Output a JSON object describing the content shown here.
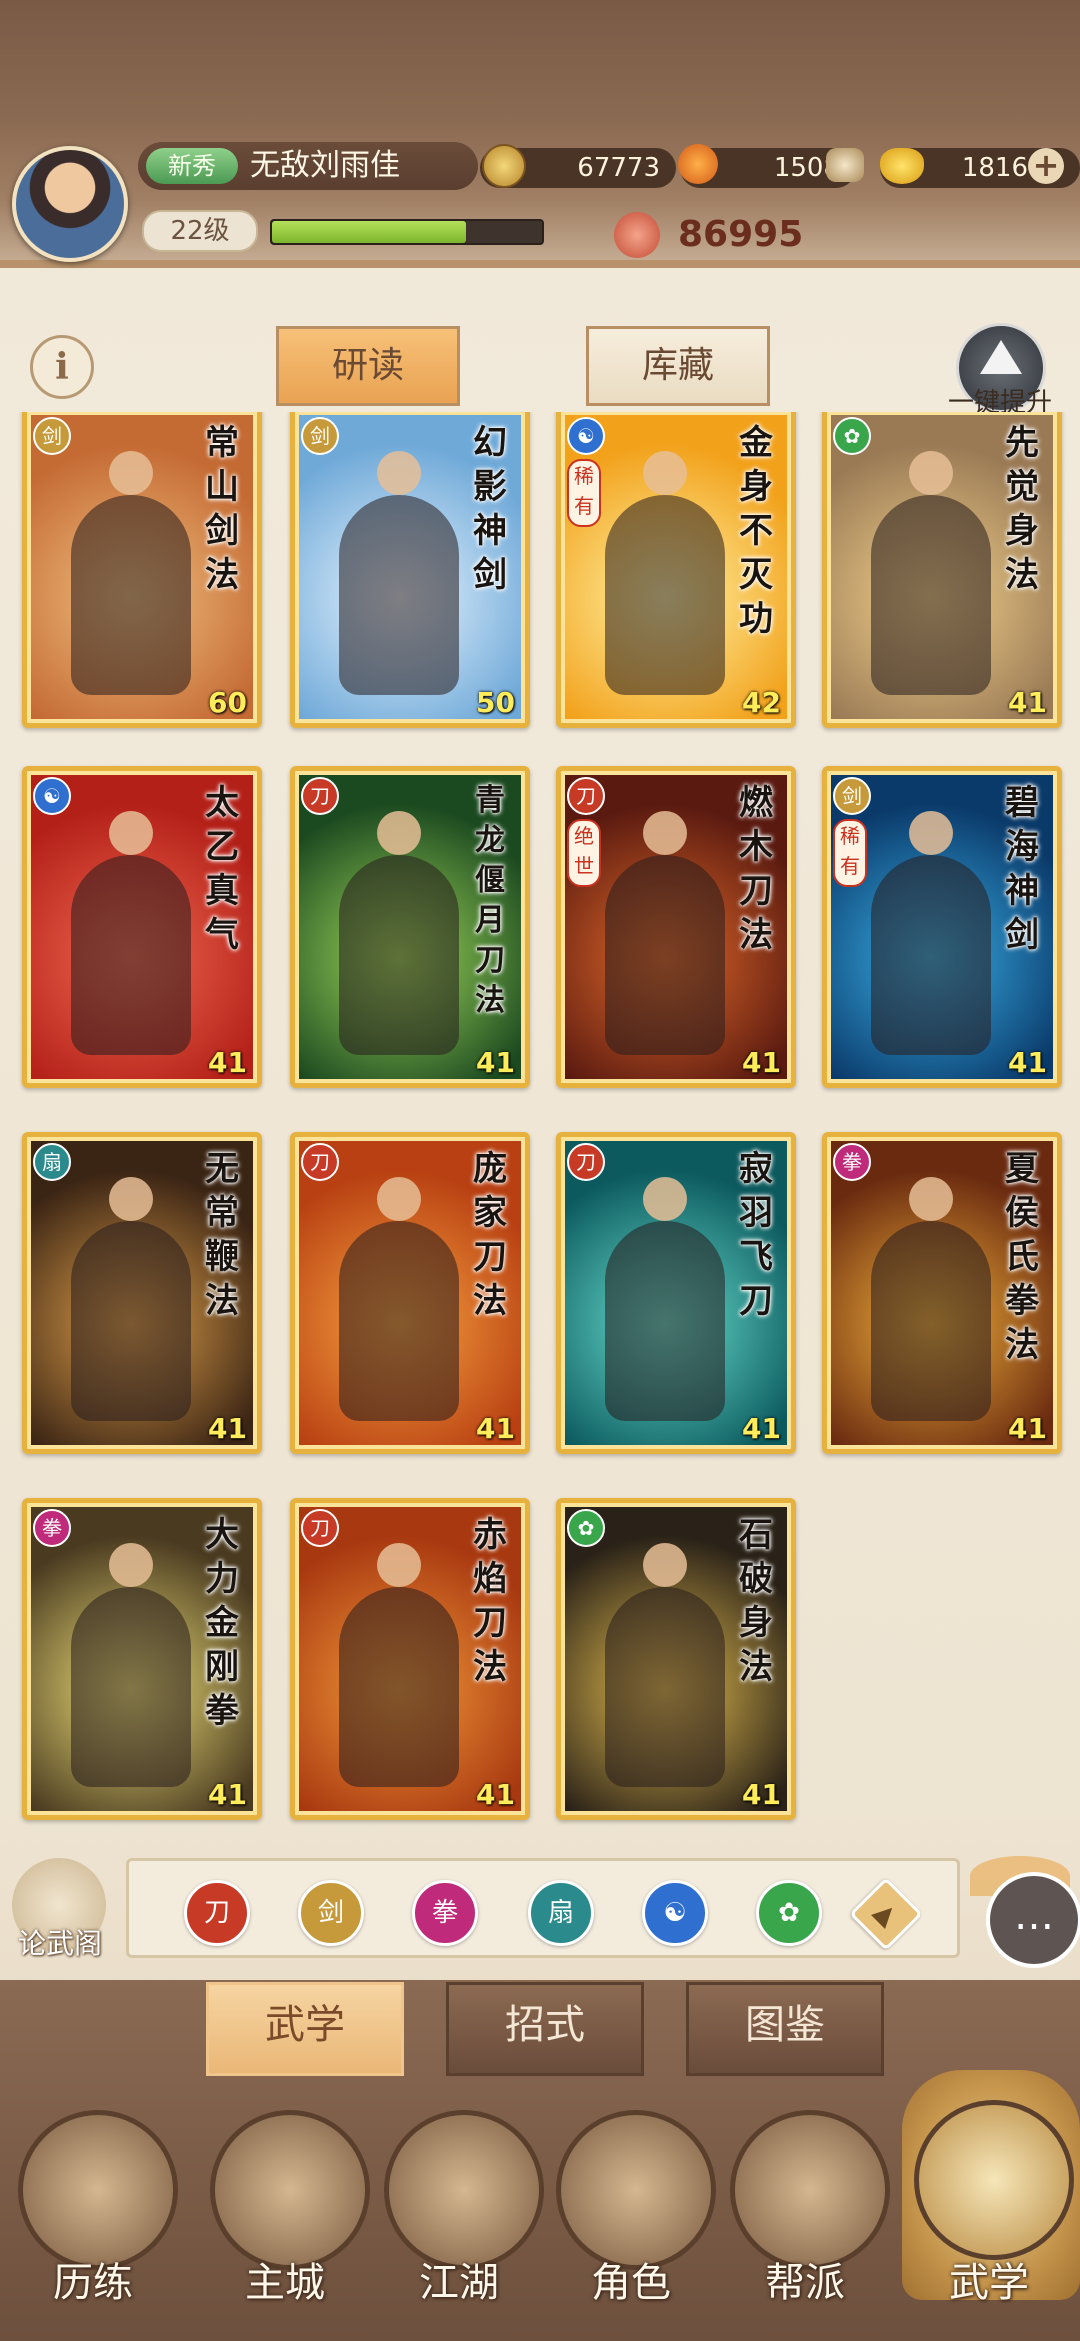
{
  "player": {
    "rank_badge": "新秀",
    "name": "无敌刘雨佳",
    "level": "22级",
    "xp_fraction": 0.72,
    "power": "86995"
  },
  "currencies": [
    {
      "icon": "copper-coin-icon",
      "value": "67773"
    },
    {
      "icon": "stamina-leaf-icon",
      "value": "1508"
    },
    {
      "icon": "gold-ingot-icon",
      "value": "1816"
    }
  ],
  "tabs": {
    "research": "研读",
    "storage": "库藏"
  },
  "upgrade": {
    "label": "一键提升"
  },
  "cards": [
    {
      "title": "常山剑法",
      "level": "60",
      "school_icon": "sword-school-icon",
      "school_color": "#c69a3a",
      "rarity": "",
      "colors": [
        "#c46a33",
        "#f0c080"
      ]
    },
    {
      "title": "幻影神剑",
      "level": "50",
      "school_icon": "sword-school-icon",
      "school_color": "#c69a3a",
      "rarity": "",
      "colors": [
        "#6fa9d8",
        "#e8f4ff"
      ]
    },
    {
      "title": "金身不灭功",
      "level": "42",
      "school_icon": "yin-yang-icon",
      "school_color": "#2e6fd0",
      "rarity": "稀有",
      "colors": [
        "#f2a11a",
        "#fff4a8"
      ]
    },
    {
      "title": "先觉身法",
      "level": "41",
      "school_icon": "leaf-school-icon",
      "school_color": "#3aa64c",
      "rarity": "",
      "colors": [
        "#9a7a55",
        "#f3d28c"
      ]
    },
    {
      "title": "太乙真气",
      "level": "41",
      "school_icon": "yin-yang-icon",
      "school_color": "#2e6fd0",
      "rarity": "",
      "colors": [
        "#b32018",
        "#f06850"
      ]
    },
    {
      "title": "青龙偃月刀法",
      "level": "41",
      "school_icon": "blade-school-icon",
      "school_color": "#c73a26",
      "rarity": "",
      "colors": [
        "#1c4a20",
        "#9fd85a"
      ]
    },
    {
      "title": "燃木刀法",
      "level": "41",
      "school_icon": "blade-school-icon",
      "school_color": "#c73a26",
      "rarity": "绝世",
      "colors": [
        "#5a1a10",
        "#e36a2a"
      ]
    },
    {
      "title": "碧海神剑",
      "level": "41",
      "school_icon": "sword-school-icon",
      "school_color": "#c69a3a",
      "rarity": "稀有",
      "colors": [
        "#0a3a6a",
        "#3ab0e8"
      ]
    },
    {
      "title": "无常鞭法",
      "level": "41",
      "school_icon": "fan-school-icon",
      "school_color": "#2a8a8c",
      "rarity": "",
      "colors": [
        "#3a2414",
        "#e0a04a"
      ]
    },
    {
      "title": "庞家刀法",
      "level": "41",
      "school_icon": "blade-school-icon",
      "school_color": "#c73a26",
      "rarity": "",
      "colors": [
        "#b84012",
        "#f7a240"
      ]
    },
    {
      "title": "寂羽飞刀",
      "level": "41",
      "school_icon": "blade-school-icon",
      "school_color": "#c73a26",
      "rarity": "",
      "colors": [
        "#0c5a5e",
        "#6ae0d0"
      ]
    },
    {
      "title": "夏侯氏拳法",
      "level": "41",
      "school_icon": "fist-school-icon",
      "school_color": "#c02a7a",
      "rarity": "",
      "colors": [
        "#6a2a10",
        "#f2b23a"
      ]
    },
    {
      "title": "大力金刚拳",
      "level": "41",
      "school_icon": "fist-school-icon",
      "school_color": "#c02a7a",
      "rarity": "",
      "colors": [
        "#4a3a20",
        "#f0e27a"
      ]
    },
    {
      "title": "赤焰刀法",
      "level": "41",
      "school_icon": "blade-school-icon",
      "school_color": "#c73a26",
      "rarity": "",
      "colors": [
        "#a83810",
        "#f29a3a"
      ]
    },
    {
      "title": "石破身法",
      "level": "41",
      "school_icon": "leaf-school-icon",
      "school_color": "#3aa64c",
      "rarity": "",
      "colors": [
        "#2a2218",
        "#e8c050"
      ]
    }
  ],
  "lunwu": {
    "label": "论武阁"
  },
  "filters": [
    {
      "icon": "blade-filter-icon",
      "color": "#c73a26"
    },
    {
      "icon": "sword-filter-icon",
      "color": "#c69a3a"
    },
    {
      "icon": "fist-filter-icon",
      "color": "#c02a7a"
    },
    {
      "icon": "fan-filter-icon",
      "color": "#2a8a8c"
    },
    {
      "icon": "yin-yang-filter-icon",
      "color": "#2e6fd0"
    },
    {
      "icon": "leaf-filter-icon",
      "color": "#3aa64c"
    },
    {
      "icon": "all-schools-filter-icon",
      "color": "#e8c27a"
    }
  ],
  "subtabs": [
    "武学",
    "招式",
    "图鉴"
  ],
  "nav": [
    "历练",
    "主城",
    "江湖",
    "角色",
    "帮派",
    "武学"
  ]
}
